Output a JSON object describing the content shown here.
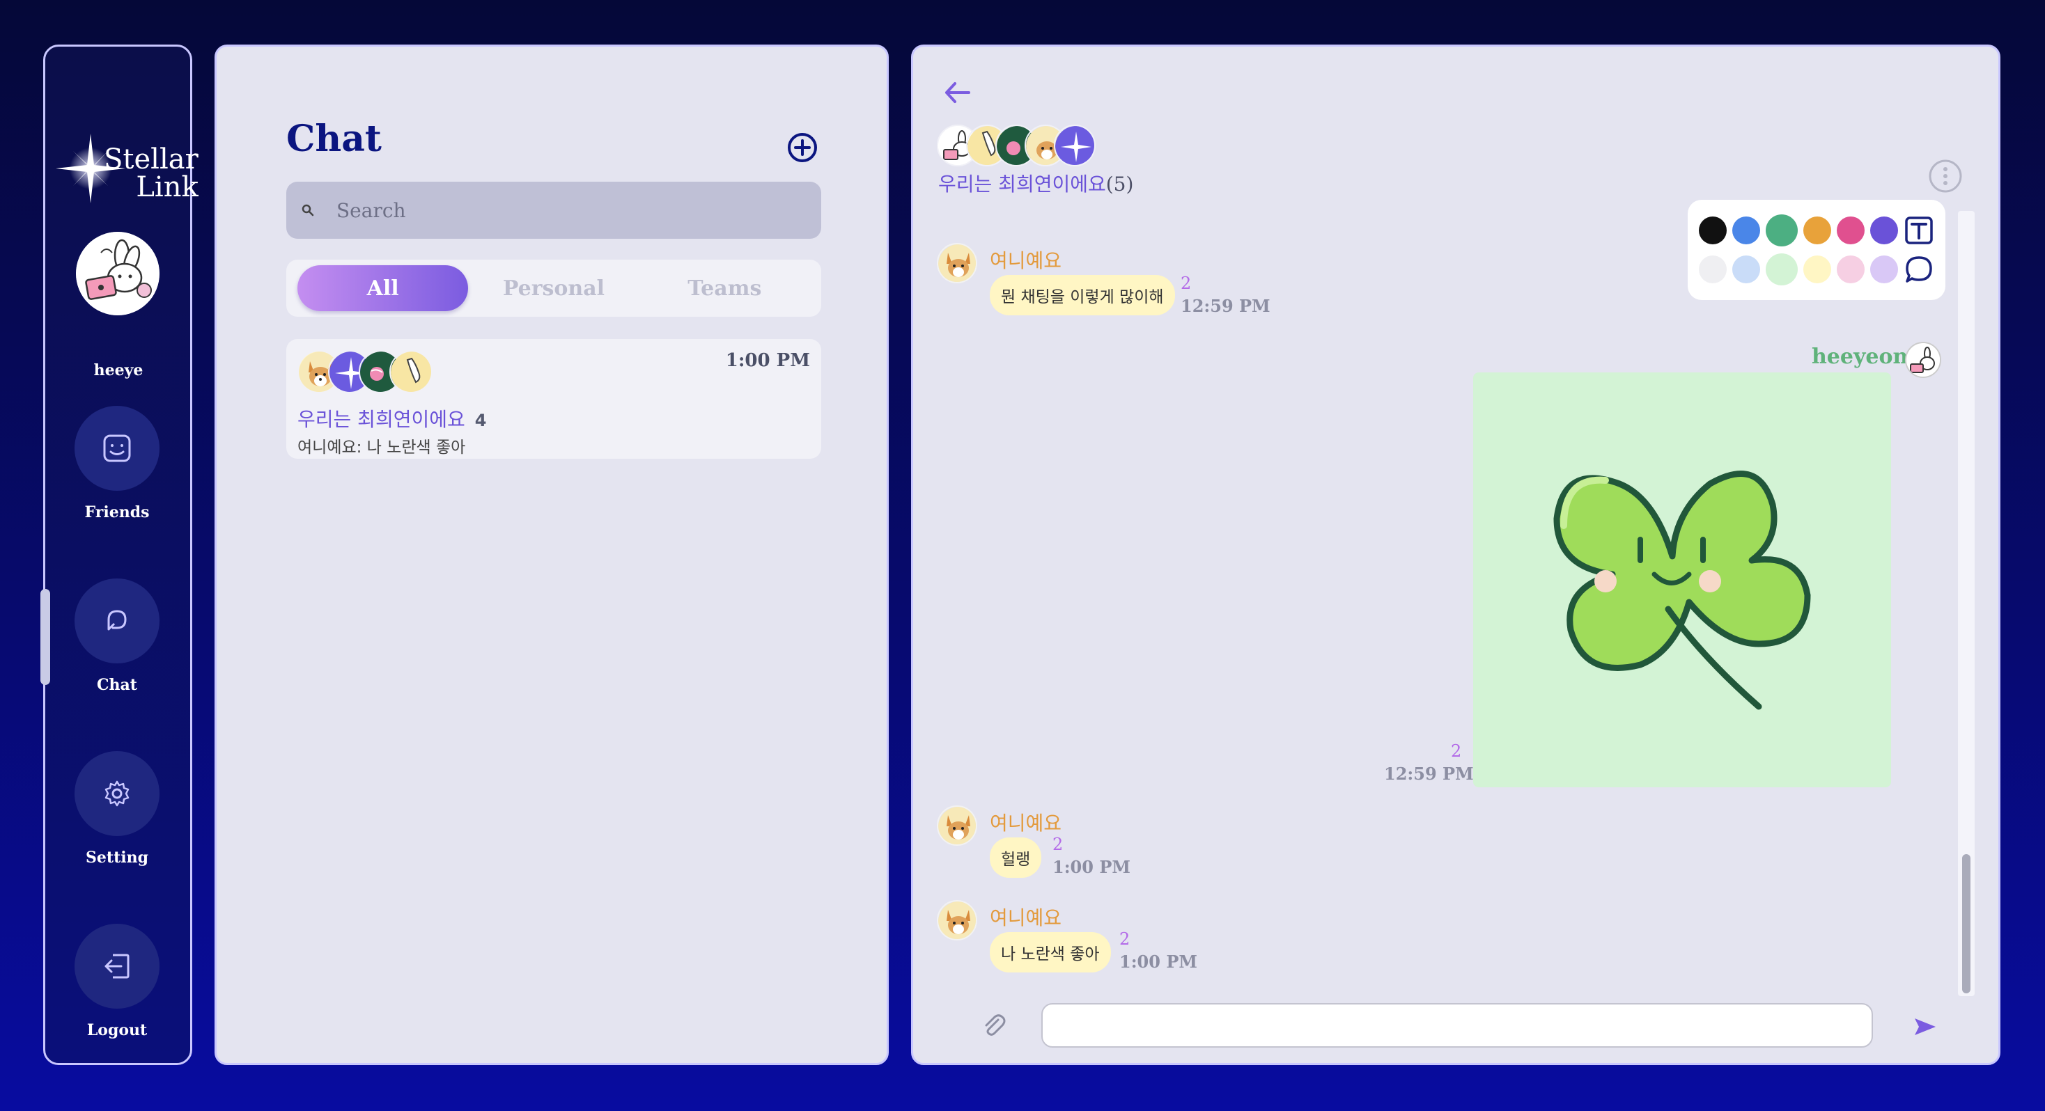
{
  "app": {
    "logo_line1": "Stellar",
    "logo_line2": "Link"
  },
  "sidebar": {
    "username": "heeye",
    "items": [
      {
        "label": "Friends",
        "icon": "smile-icon"
      },
      {
        "label": "Chat",
        "icon": "chat-bubble-icon"
      },
      {
        "label": "Setting",
        "icon": "gear-icon"
      },
      {
        "label": "Logout",
        "icon": "logout-icon"
      }
    ],
    "active": "Chat"
  },
  "chat_list": {
    "title": "Chat",
    "search_placeholder": "Search",
    "tabs": [
      {
        "label": "All",
        "active": true
      },
      {
        "label": "Personal",
        "active": false
      },
      {
        "label": "Teams",
        "active": false
      }
    ],
    "rooms": [
      {
        "name": "우리는 최희연이에요",
        "member_count": "4",
        "time": "1:00 PM",
        "preview": "여니예요: 나 노란색 좋아"
      }
    ]
  },
  "room": {
    "title": "우리는 최희연이에요",
    "member_count": "(5)",
    "palette": {
      "row1": [
        "#111111",
        "#4a86e8",
        "#4caf82",
        "#e8a23a",
        "#e0508f",
        "#6a52d8"
      ],
      "row2": [
        "#efeff2",
        "#c9dcf8",
        "#d3f3d5",
        "#fff6c4",
        "#f6cfe3",
        "#d9c8f6"
      ]
    },
    "messages": [
      {
        "sender": "여니예요",
        "text": "뭔 채팅을 이렇게 많이해",
        "unread": "2",
        "time": "12:59 PM"
      },
      {
        "sender": "heeyeon",
        "type": "sticker",
        "sticker": "clover-sticker",
        "unread": "2",
        "time": "12:59 PM"
      },
      {
        "sender": "여니예요",
        "text": "헐랭",
        "unread": "2",
        "time": "1:00 PM"
      },
      {
        "sender": "여니예요",
        "text": "나 노란색 좋아",
        "unread": "2",
        "time": "1:00 PM"
      }
    ],
    "input_placeholder": ""
  },
  "colors": {
    "accent": "#6a52d8",
    "title_navy": "#0b1580",
    "sender_orange": "#e39a3c",
    "me_green": "#5fb27a",
    "bubble_yellow": "#fff6c4",
    "sticker_bg": "#d3f3d5"
  }
}
